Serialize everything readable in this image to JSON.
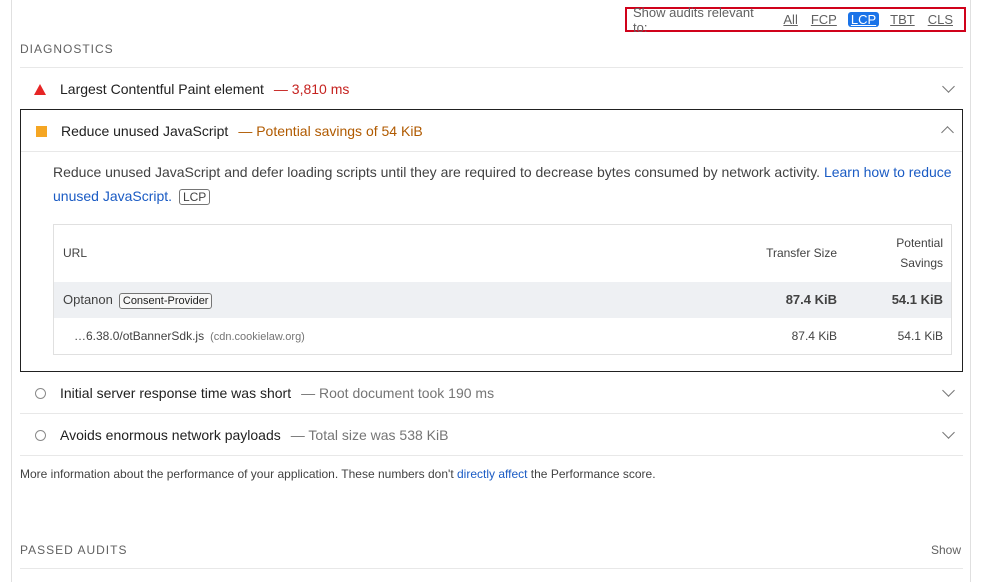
{
  "filter": {
    "label": "Show audits relevant to:",
    "options": [
      "All",
      "FCP",
      "LCP",
      "TBT",
      "CLS"
    ],
    "active": "LCP"
  },
  "diagnostics": {
    "title": "DIAGNOSTICS",
    "audits": [
      {
        "title": "Largest Contentful Paint element",
        "display": "— 3,810 ms",
        "status": "fail",
        "icon": "warning-triangle-icon"
      },
      {
        "title": "Reduce unused JavaScript",
        "display": "— Potential savings of 54 KiB",
        "status": "average",
        "icon": "average-square-icon"
      },
      {
        "title": "Initial server response time was short",
        "display": "— Root document took 190 ms",
        "status": "pass",
        "icon": "info-circle-icon"
      },
      {
        "title": "Avoids enormous network payloads",
        "display": "— Total size was 538 KiB",
        "status": "pass",
        "icon": "info-circle-icon"
      }
    ],
    "expanded": {
      "description": "Reduce unused JavaScript and defer loading scripts until they are required to decrease bytes consumed by network activity.",
      "learn_more": "Learn how to reduce unused JavaScript.",
      "chip": "LCP",
      "table": {
        "headers": {
          "url": "URL",
          "transfer": "Transfer Size",
          "savings_line1": "Potential",
          "savings_line2": "Savings"
        },
        "group": {
          "name": "Optanon",
          "chip": "Consent-Provider",
          "transfer": "87.4 KiB",
          "savings": "54.1 KiB"
        },
        "item": {
          "url": "…6.38.0/otBannerSdk.js",
          "domain": "(cdn.cookielaw.org)",
          "transfer": "87.4 KiB",
          "savings": "54.1 KiB"
        }
      }
    },
    "note_before": "More information about the performance of your application. These numbers don't ",
    "note_link": "directly affect",
    "note_after": " the Performance score."
  },
  "passed": {
    "title": "PASSED AUDITS",
    "show": "Show"
  },
  "colors": {
    "fail": "#e62525",
    "average": "#f5a623",
    "accent": "#1a73e8",
    "highlight": "#d0021b"
  }
}
